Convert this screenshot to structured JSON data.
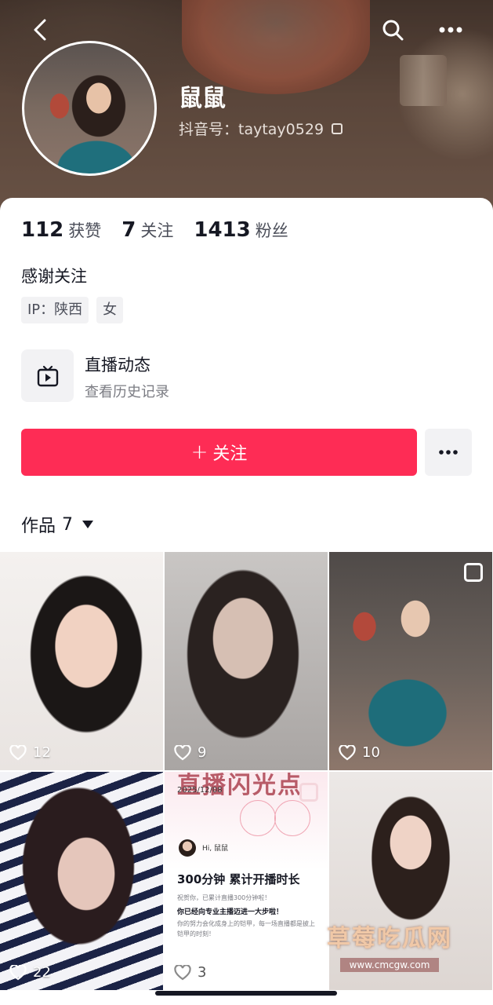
{
  "profile": {
    "nickname": "鼠鼠",
    "douyin_id": "抖音号：taytay0529",
    "signature": "感谢关注",
    "tags": [
      "IP：陕西",
      "女"
    ]
  },
  "stats": [
    {
      "num": "112",
      "label": "获赞"
    },
    {
      "num": "7",
      "label": "关注"
    },
    {
      "num": "1413",
      "label": "粉丝"
    }
  ],
  "live": {
    "title": "直播动态",
    "subtitle": "查看历史记录"
  },
  "actions": {
    "follow_plus": "+",
    "follow_label": "关注"
  },
  "works": {
    "label": "作品",
    "count": "7"
  },
  "grid": [
    {
      "likes": "12",
      "pinned": false
    },
    {
      "likes": "9",
      "pinned": false
    },
    {
      "likes": "10",
      "pinned": true
    },
    {
      "likes": "22",
      "pinned": false
    },
    {
      "likes": "3",
      "pinned": true
    },
    {
      "likes": "",
      "pinned": false
    }
  ],
  "report": {
    "title": "直播闪光点",
    "date": "2025/12/08",
    "greeting": "Hi, 鼠鼠",
    "headline": "300分钟  累计开播时长",
    "line1": "祝贺你，已累计直播300分钟啦！",
    "line2": "你已经向专业主播迈进一大步啦！",
    "line3": "你的努力会化成身上的铠甲，每一场直播都是披上铠甲的时刻！"
  },
  "watermark": {
    "main": "草莓吃瓜网",
    "url": "www.cmcgw.com"
  },
  "colors": {
    "accent": "#fe2c55",
    "text": "#161823",
    "muted": "#7b7c83"
  }
}
